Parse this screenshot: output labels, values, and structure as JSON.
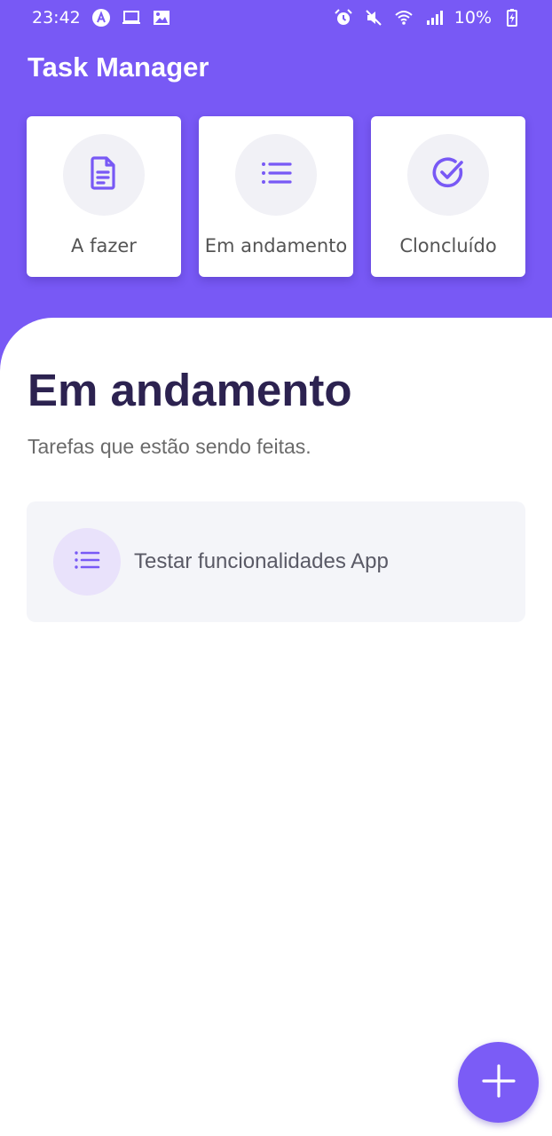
{
  "status_bar": {
    "time": "23:42",
    "battery": "10%",
    "left_icons": [
      "app-notification-icon",
      "laptop-icon",
      "image-icon"
    ],
    "right_icons": [
      "alarm-icon",
      "mute-icon",
      "wifi-icon",
      "signal-icon",
      "battery-charging-icon"
    ]
  },
  "header": {
    "title": "Task Manager"
  },
  "categories": [
    {
      "label": "A fazer",
      "icon": "document-icon"
    },
    {
      "label": "Em andamento",
      "icon": "list-icon"
    },
    {
      "label": "Cloncluído",
      "icon": "check-circle-icon"
    }
  ],
  "section": {
    "title": "Em andamento",
    "subtitle": "Tarefas que estão sendo feitas."
  },
  "tasks": [
    {
      "label": "Testar funcionalidades App",
      "icon": "list-icon"
    }
  ],
  "fab": {
    "icon": "plus-icon"
  },
  "colors": {
    "primary": "#7859f5",
    "heading": "#2c2250",
    "card_bg": "#ffffff",
    "task_bg": "#f4f5f9",
    "icon_circle_bg": "#f1f1f6",
    "task_icon_circle_bg": "#e9e2fb"
  }
}
